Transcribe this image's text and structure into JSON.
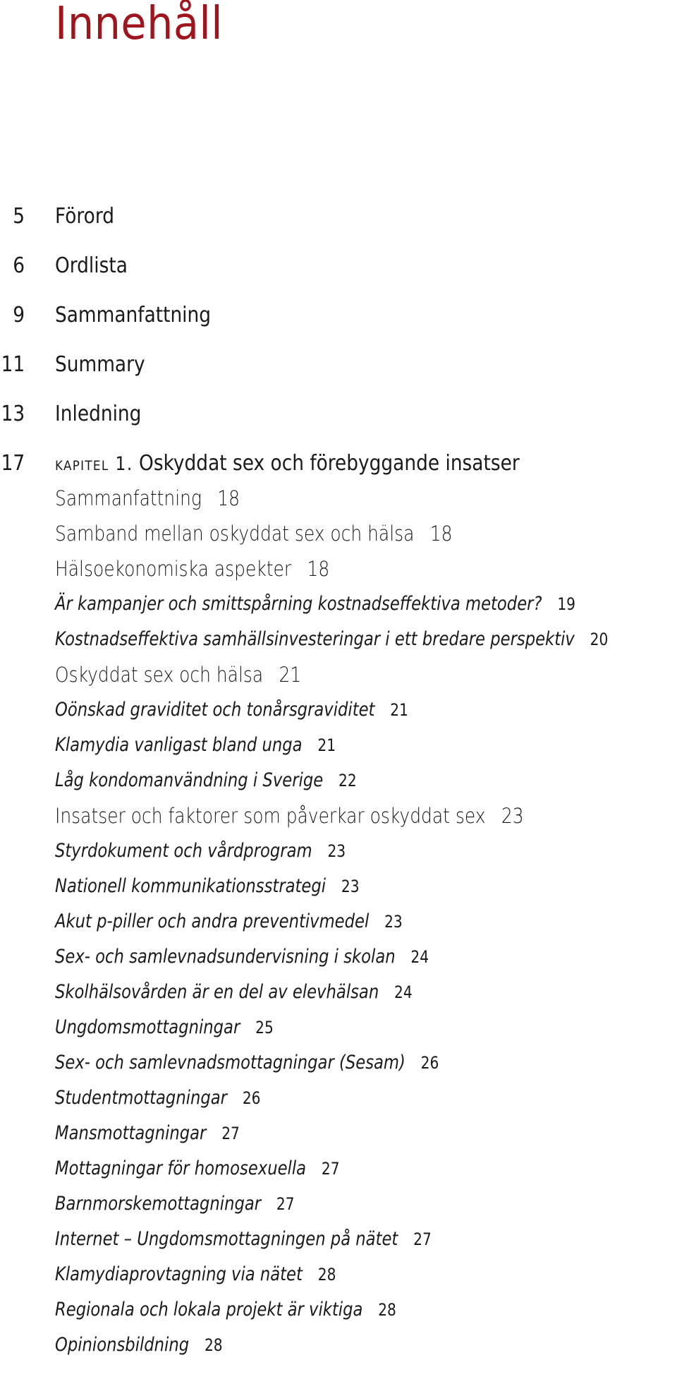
{
  "title": "Innehåll",
  "accent_color": "#a0141e",
  "front_matter": [
    {
      "page": "5",
      "label": "Förord"
    },
    {
      "page": "6",
      "label": "Ordlista"
    },
    {
      "page": "9",
      "label": "Sammanfattning"
    },
    {
      "page": "11",
      "label": "Summary"
    },
    {
      "page": "13",
      "label": "Inledning"
    }
  ],
  "chapter": {
    "page": "17",
    "kapitel_label": "kapitel 1.",
    "title": "Oskyddat sex och förebyggande insatser"
  },
  "sections": [
    {
      "label": "Sammanfattning",
      "page": "18",
      "style": "section"
    },
    {
      "label": "Samband mellan oskyddat sex och hälsa",
      "page": "18",
      "style": "section"
    },
    {
      "label": "Hälsoekonomiska aspekter",
      "page": "18",
      "style": "section"
    },
    {
      "label": "Är kampanjer och smittspårning kostnadseffektiva metoder?",
      "page": "19",
      "style": "subsection"
    },
    {
      "label": "Kostnadseffektiva samhällsinvesteringar i ett bredare perspektiv",
      "page": "20",
      "style": "subsection"
    },
    {
      "label": "Oskyddat sex och hälsa",
      "page": "21",
      "style": "section"
    },
    {
      "label": "Oönskad graviditet och tonårsgraviditet",
      "page": "21",
      "style": "subsection"
    },
    {
      "label": "Klamydia vanligast bland unga",
      "page": "21",
      "style": "subsection"
    },
    {
      "label": "Låg kondomanvändning i Sverige",
      "page": "22",
      "style": "subsection"
    },
    {
      "label": "Insatser och faktorer som påverkar oskyddat sex",
      "page": "23",
      "style": "section"
    },
    {
      "label": "Styrdokument och vårdprogram",
      "page": "23",
      "style": "subsection"
    },
    {
      "label": "Nationell kommunikationsstrategi",
      "page": "23",
      "style": "subsection"
    },
    {
      "label": "Akut p-piller och andra preventivmedel",
      "page": "23",
      "style": "subsection"
    },
    {
      "label": "Sex- och samlevnadsundervisning i skolan",
      "page": "24",
      "style": "subsection"
    },
    {
      "label": "Skolhälsovården är en del av elevhälsan",
      "page": "24",
      "style": "subsection"
    },
    {
      "label": "Ungdomsmottagningar",
      "page": "25",
      "style": "subsection"
    },
    {
      "label": "Sex- och samlevnadsmottagningar (Sesam)",
      "page": "26",
      "style": "subsection"
    },
    {
      "label": "Studentmottagningar",
      "page": "26",
      "style": "subsection"
    },
    {
      "label": "Mansmottagningar",
      "page": "27",
      "style": "subsection"
    },
    {
      "label": "Mottagningar för homosexuella",
      "page": "27",
      "style": "subsection"
    },
    {
      "label": "Barnmorskemottagningar",
      "page": "27",
      "style": "subsection"
    },
    {
      "label": "Internet – Ungdomsmottagningen på nätet",
      "page": "27",
      "style": "subsection"
    },
    {
      "label": "Klamydiaprovtagning via nätet",
      "page": "28",
      "style": "subsection"
    },
    {
      "label": "Regionala och lokala projekt är viktiga",
      "page": "28",
      "style": "subsection"
    },
    {
      "label": "Opinionsbildning",
      "page": "28",
      "style": "subsection"
    }
  ]
}
